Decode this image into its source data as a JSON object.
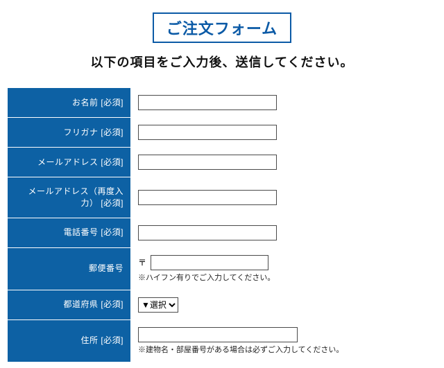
{
  "header": {
    "title": "ご注文フォーム",
    "subtitle": "以下の項目をご入力後、送信してください。"
  },
  "fields": {
    "name": {
      "label": "お名前 [必須]"
    },
    "kana": {
      "label": "フリガナ [必須]"
    },
    "email": {
      "label": "メールアドレス [必須]"
    },
    "email2": {
      "label": "メールアドレス（再度入力） [必須]"
    },
    "phone": {
      "label": "電話番号 [必須]"
    },
    "postal": {
      "label": "郵便番号",
      "mark": "〒",
      "helper": "※ハイフン有りでご入力してください。"
    },
    "pref": {
      "label": "都道府県 [必須]",
      "selected": "▼選択"
    },
    "address": {
      "label": "住所 [必須]",
      "helper": "※建物名・部屋番号がある場合は必ずご入力してください。"
    }
  }
}
